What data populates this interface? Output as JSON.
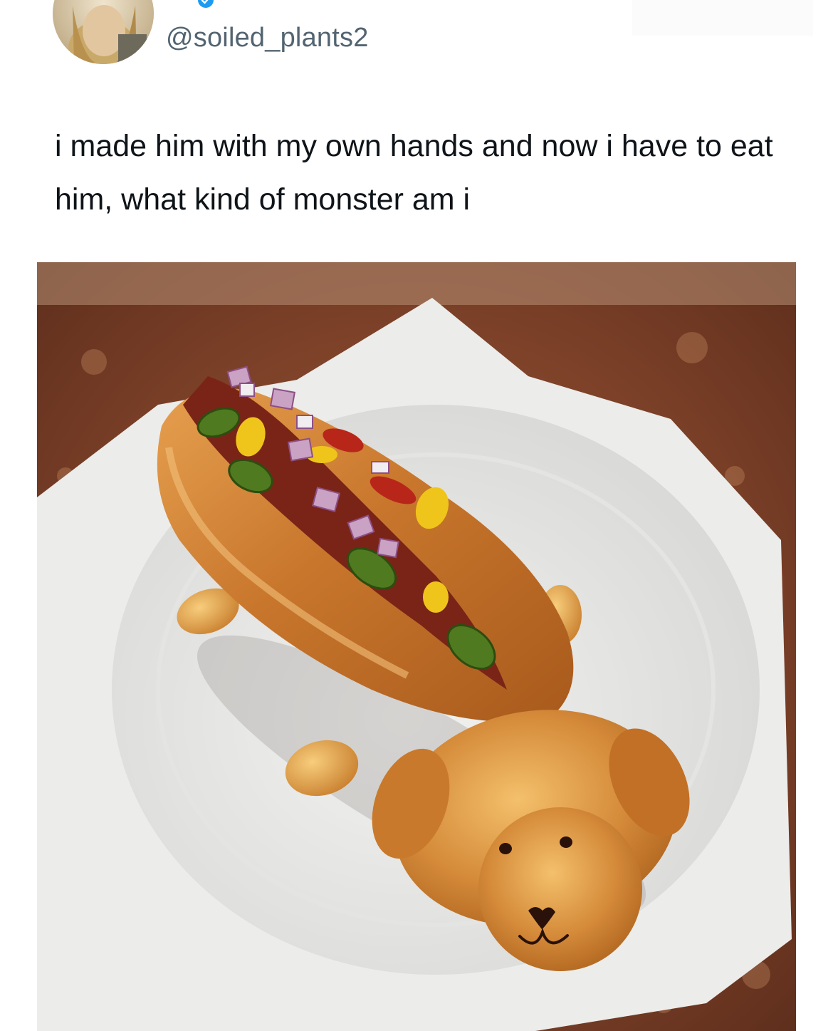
{
  "post": {
    "handle": "@soiled_plants2",
    "text": "i made him with my own hands and now i have to eat him, what kind of monster am i"
  },
  "colors": {
    "handle": "#536471",
    "text": "#0f1419",
    "verified": "#1d9bf0"
  },
  "icons": {
    "verified": "verified-badge-icon"
  }
}
